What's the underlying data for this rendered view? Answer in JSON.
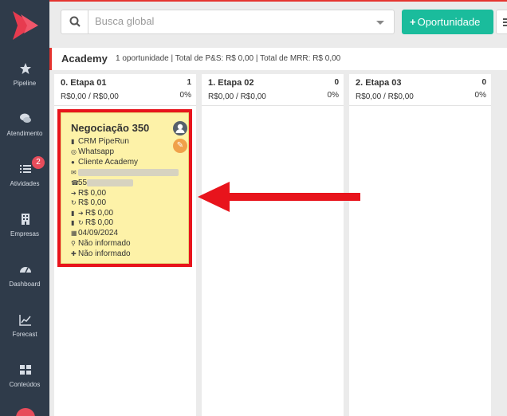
{
  "sidebar": {
    "items": [
      {
        "label": "Pipeline",
        "icon": "star-icon"
      },
      {
        "label": "Atendimento",
        "icon": "chat-icon"
      },
      {
        "label": "Atividades",
        "icon": "list-icon",
        "badge": "2"
      },
      {
        "label": "Empresas",
        "icon": "building-icon"
      },
      {
        "label": "Dashboard",
        "icon": "dashboard-icon"
      },
      {
        "label": "Forecast",
        "icon": "chart-line-icon"
      },
      {
        "label": "Conteúdos",
        "icon": "grid-icon"
      }
    ]
  },
  "topbar": {
    "search_placeholder": "Busca global",
    "new_opportunity": "Oportunidade",
    "new_opportunity_prefix": "+"
  },
  "pipeline": {
    "name": "Academy",
    "info": "1 oportunidade | Total de P&S: R$ 0,00 | Total de MRR: R$ 0,00"
  },
  "columns": [
    {
      "title": "0. Etapa 01",
      "count": "1",
      "money": "R$0,00 / R$0,00",
      "pct": "0%"
    },
    {
      "title": "1. Etapa 02",
      "count": "0",
      "money": "R$0,00 / R$0,00",
      "pct": "0%"
    },
    {
      "title": "2. Etapa 03",
      "count": "0",
      "money": "R$0,00 / R$0,00",
      "pct": "0%"
    }
  ],
  "card": {
    "title": "Negociação 350",
    "company": "CRM PipeRun",
    "origin": "Whatsapp",
    "person": "Cliente Academy",
    "phone_prefix": "55",
    "value_ps": "R$ 0,00",
    "value_mrr": "R$ 0,00",
    "value_doc_ps": "R$ 0,00",
    "value_doc_mrr": "R$ 0,00",
    "date": "04/09/2024",
    "location": "Não informado",
    "segment": "Não informado"
  },
  "colors": {
    "sidebar": "#2f3b4a",
    "accent_red": "#e5342f",
    "button_green": "#1abc9c",
    "card_yellow": "#fdf2a8",
    "arrow_red": "#e8141c"
  }
}
